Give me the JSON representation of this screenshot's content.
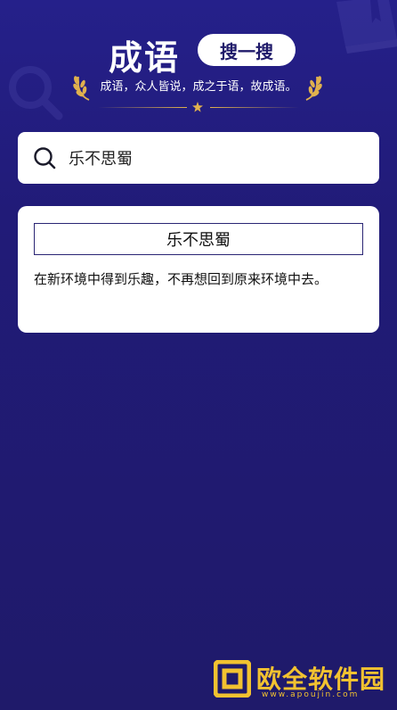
{
  "header": {
    "title": "成语",
    "search_button_label": "搜一搜",
    "subtitle": "成语，众人皆说，成之于语，故成语。"
  },
  "search": {
    "value": "乐不思蜀"
  },
  "result": {
    "title": "乐不思蜀",
    "description": "在新环境中得到乐趣，不再想回到原来环境中去。"
  },
  "watermark": {
    "text": "欧全软件园",
    "url": "www.apoujin.com"
  },
  "colors": {
    "background": "#211b78",
    "accent_gold": "#e0b14e",
    "watermark": "#f2c230"
  }
}
